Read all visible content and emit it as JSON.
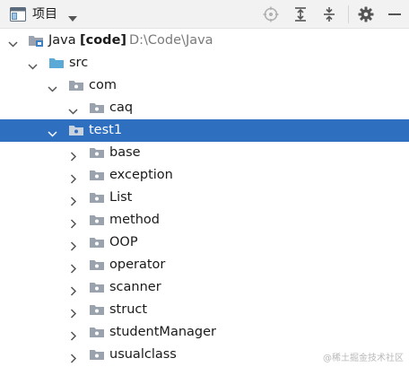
{
  "toolbar": {
    "title": "项目",
    "icons": {
      "view": "project-view-icon",
      "dropdown": "chevron-down-icon",
      "locate": "locate-icon",
      "expand": "expand-all-icon",
      "collapse": "collapse-all-icon",
      "settings": "gear-icon",
      "hide": "minimize-icon"
    }
  },
  "tree": {
    "root": {
      "name": "Java",
      "module": "[code]",
      "path": "D:\\Code\\Java"
    },
    "src": {
      "label": "src"
    },
    "com": {
      "label": "com"
    },
    "caq": {
      "label": "caq"
    },
    "test1": {
      "label": "test1",
      "selected": true
    },
    "packages": [
      {
        "label": "base"
      },
      {
        "label": "exception"
      },
      {
        "label": "List"
      },
      {
        "label": "method"
      },
      {
        "label": "OOP"
      },
      {
        "label": "operator"
      },
      {
        "label": "scanner"
      },
      {
        "label": "struct"
      },
      {
        "label": "studentManager"
      },
      {
        "label": "usualclass"
      }
    ]
  },
  "colors": {
    "selection": "#2f6fc0",
    "folder_blue": "#5aa9d6",
    "folder_gray": "#9aa3ad",
    "toolbar_bg": "#f2f2f2"
  },
  "watermark": "@稀土掘金技术社区"
}
